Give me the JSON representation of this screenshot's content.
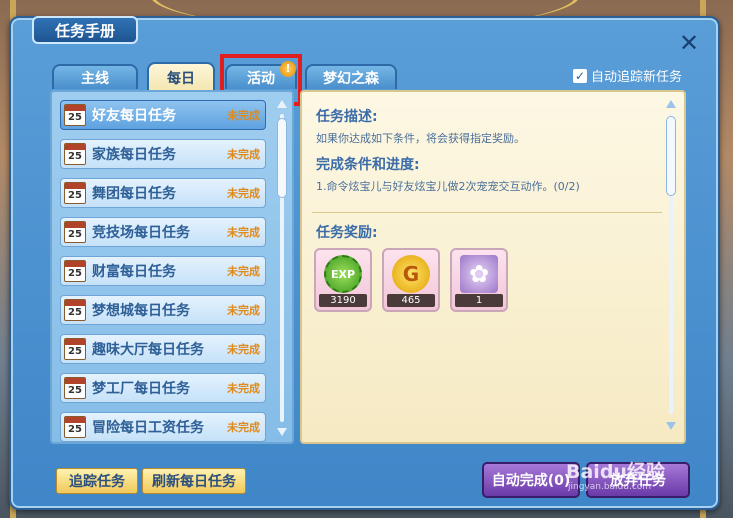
{
  "window": {
    "title": "任务手册",
    "close_symbol": "✕"
  },
  "tabs": [
    {
      "label": "主线",
      "active": false
    },
    {
      "label": "每日",
      "active": true
    },
    {
      "label": "活动",
      "active": false,
      "badge": "!"
    },
    {
      "label": "梦幻之森",
      "active": false
    }
  ],
  "auto_track": {
    "label": "自动追踪新任务",
    "checked": true,
    "check_symbol": "✓"
  },
  "task_list": [
    {
      "name": "好友每日任务",
      "status": "未完成",
      "selected": true
    },
    {
      "name": "家族每日任务",
      "status": "未完成",
      "selected": false
    },
    {
      "name": "舞团每日任务",
      "status": "未完成",
      "selected": false
    },
    {
      "name": "竞技场每日任务",
      "status": "未完成",
      "selected": false
    },
    {
      "name": "财富每日任务",
      "status": "未完成",
      "selected": false
    },
    {
      "name": "梦想城每日任务",
      "status": "未完成",
      "selected": false
    },
    {
      "name": "趣味大厅每日任务",
      "status": "未完成",
      "selected": false
    },
    {
      "name": "梦工厂每日任务",
      "status": "未完成",
      "selected": false
    },
    {
      "name": "冒险每日工资任务",
      "status": "未完成",
      "selected": false
    }
  ],
  "detail": {
    "description_title": "任务描述:",
    "description_text": "如果你达成如下条件，将会获得指定奖励。",
    "conditions_title": "完成条件和进度:",
    "conditions_text": "1.命令炫宝儿与好友炫宝儿做2次宠宠交互动作。(0/2)",
    "rewards_title": "任务奖励:",
    "rewards": [
      {
        "icon": "exp-icon",
        "icon_text": "EXP",
        "qty": "3190"
      },
      {
        "icon": "gold-coin-icon",
        "icon_text": "G",
        "qty": "465"
      },
      {
        "icon": "flower-item-icon",
        "icon_text": "✿",
        "qty": "1"
      }
    ]
  },
  "buttons": {
    "track": "追踪任务",
    "refresh": "刷新每日任务",
    "auto_complete": "自动完成(0)",
    "abandon": "放弃任务"
  },
  "watermark": {
    "brand": "Baidu经验",
    "url": "jingyan.baidu.com"
  },
  "colors": {
    "window_blue": "#3f86c8",
    "highlight_red": "#e21d1d",
    "status_orange": "#e08a1a",
    "purple_button": "#6a3aa8"
  }
}
